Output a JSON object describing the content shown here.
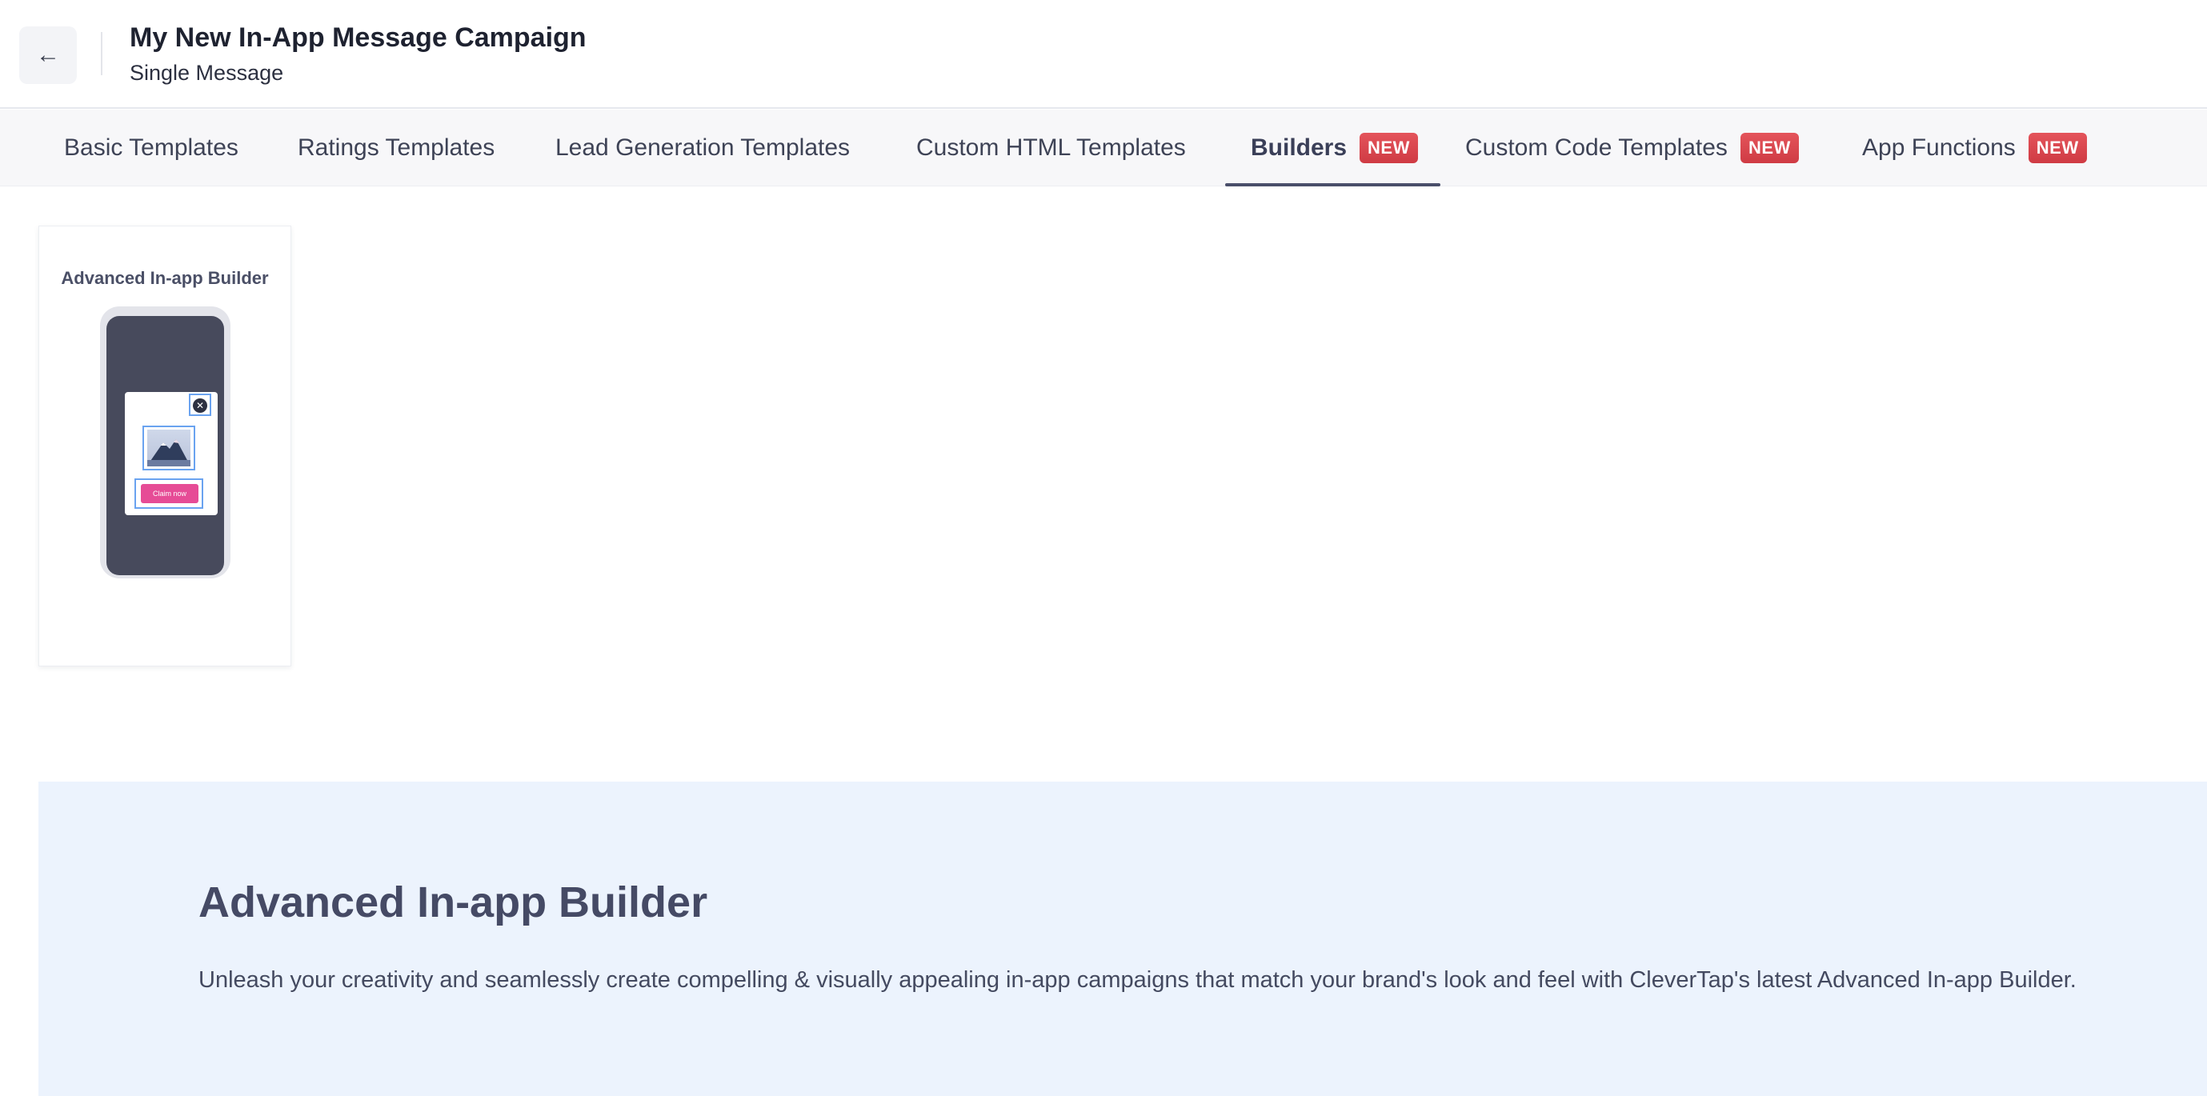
{
  "header": {
    "back_icon": "arrow-left-icon",
    "title": "My New In-App Message Campaign",
    "subtitle": "Single Message"
  },
  "tabs": [
    {
      "label": "Basic Templates",
      "active": false,
      "badge": ""
    },
    {
      "label": "Ratings Templates",
      "active": false,
      "badge": ""
    },
    {
      "label": "Lead Generation Templates",
      "active": false,
      "badge": ""
    },
    {
      "label": "Custom HTML Templates",
      "active": false,
      "badge": ""
    },
    {
      "label": "Builders",
      "active": true,
      "badge": "NEW"
    },
    {
      "label": "Custom Code Templates",
      "active": false,
      "badge": "NEW"
    },
    {
      "label": "App Functions",
      "active": false,
      "badge": "NEW"
    }
  ],
  "templates": [
    {
      "title": "Advanced In-app Builder",
      "preview_button_label": "Claim now"
    }
  ],
  "info": {
    "title": "Advanced In-app Builder",
    "description": "Unleash your creativity and seamlessly create compelling & visually appealing in-app campaigns that match your brand's look and feel with CleverTap's latest Advanced In-app Builder."
  },
  "colors": {
    "badge": "#d9444c",
    "info_panel_bg": "#ecf3fd",
    "active_tab_underline": "#4a4f6a",
    "preview_button": "#e64c96"
  }
}
